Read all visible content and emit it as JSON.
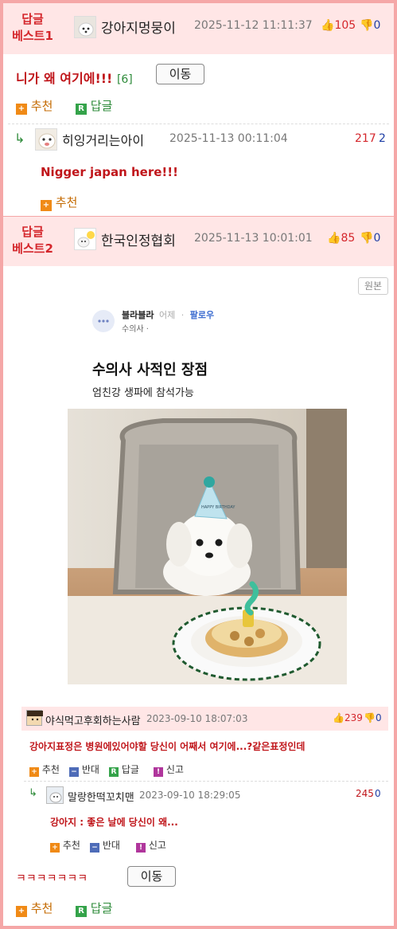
{
  "best1": {
    "tag_line1": "답글",
    "tag_line2": "베스트1",
    "nickname": "강아지멍뭉이",
    "date": "2025-11-12 11:11:37",
    "up": "105",
    "down": "0",
    "body": "니가 왜 여기에!!!",
    "reply_count": "[6]",
    "move_label": "이동",
    "recommend_label": "추천",
    "reply_label": "답글"
  },
  "sub1": {
    "nickname": "히잉거리는아이",
    "date": "2025-11-13 00:11:04",
    "up": "217",
    "down": "2",
    "body": "Nigger japan here!!!",
    "recommend_label": "추천"
  },
  "best2": {
    "tag_line1": "답글",
    "tag_line2": "베스트2",
    "nickname": "한국인정협회",
    "date": "2025-11-13 10:01:01",
    "up": "85",
    "down": "0",
    "original_label": "원본",
    "body": "ㅋㅋㅋㅋㅋㅋㅋ",
    "move_label": "이동",
    "recommend_label": "추천",
    "reply_label": "답글"
  },
  "embed": {
    "post_user": "블라블라",
    "post_time": "어제",
    "post_follow": "팔로우",
    "post_job": "수의사 ·",
    "title": "수의사 사적인 장점",
    "subtitle": "엄친강 생파에 참석가능",
    "hat_text": "HAPPY BIRTHDAY",
    "comment1": {
      "nickname": "야식먹고후회하는사람",
      "date": "2023-09-10 18:07:03",
      "up": "239",
      "down": "0",
      "body": "강아지표정은 병원에있어야할 당신이 어째서 여기에...?같은표정인데",
      "recommend": "추천",
      "oppose": "반대",
      "reply": "답글",
      "report": "신고"
    },
    "comment2": {
      "nickname": "말랑한떡꼬치맨",
      "date": "2023-09-10 18:29:05",
      "score": "245",
      "score2": "0",
      "body": "강아지 : 좋은 날에 당신이 왜...",
      "recommend": "추천",
      "oppose": "반대",
      "report": "신고"
    }
  },
  "colors": {
    "accent_red": "#d4262b",
    "header_pink": "#ffe6e6",
    "frame_pink": "#f5a7a7"
  }
}
